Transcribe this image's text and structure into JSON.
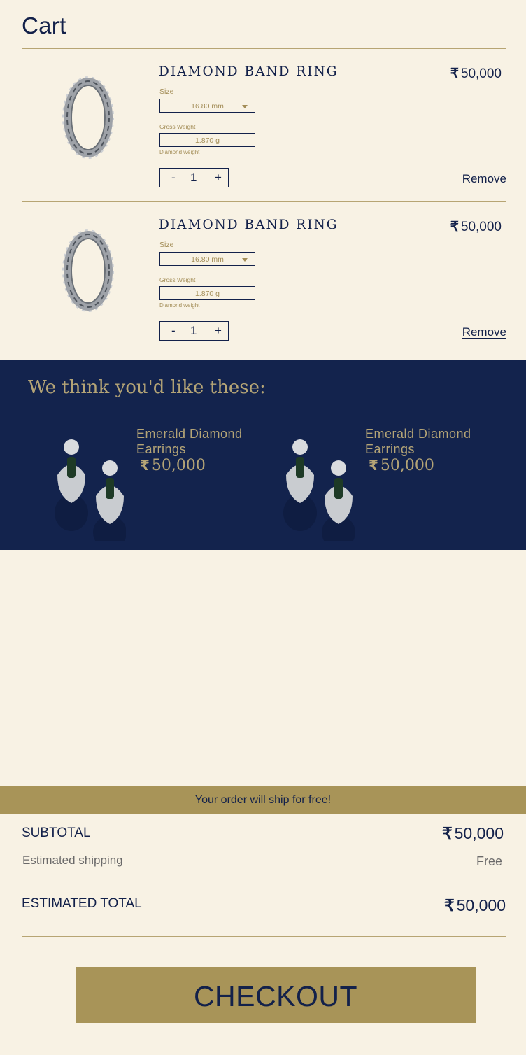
{
  "page": {
    "title": "Cart"
  },
  "cart": {
    "items": [
      {
        "name": "DIAMOND BAND RING",
        "currency": "₹",
        "price": "50,000",
        "size_label": "Size",
        "size_value": "16.80 mm",
        "gross_weight_label": "Gross Weight",
        "gross_weight_value": "1.870 g",
        "diamond_weight_label": "Diamond weight",
        "qty_minus": "-",
        "qty_value": "1",
        "qty_plus": "+",
        "remove_label": "Remove"
      },
      {
        "name": "DIAMOND BAND RING",
        "currency": "₹",
        "price": "50,000",
        "size_label": "Size",
        "size_value": "16.80 mm",
        "gross_weight_label": "Gross Weight",
        "gross_weight_value": "1.870 g",
        "diamond_weight_label": "Diamond weight",
        "qty_minus": "-",
        "qty_value": "1",
        "qty_plus": "+",
        "remove_label": "Remove"
      }
    ]
  },
  "recommendations": {
    "title": "We think you'd like these:",
    "products": [
      {
        "name": "Emerald Diamond Earrings",
        "currency": "₹",
        "price": "50,000"
      },
      {
        "name": "Emerald Diamond Earrings",
        "currency": "₹",
        "price": "50,000"
      }
    ]
  },
  "shipping_banner": "Your order will ship for free!",
  "summary": {
    "subtotal_label": "SUBTOTAL",
    "subtotal_currency": "₹",
    "subtotal_value": "50,000",
    "shipping_label": "Estimated shipping",
    "shipping_value": "Free",
    "total_label": "ESTIMATED TOTAL",
    "total_currency": "₹",
    "total_value": "50,000"
  },
  "checkout_label": "CHECKOUT",
  "colors": {
    "background": "#f8f2e4",
    "navy": "#13214a",
    "gold": "#a89458",
    "reco_background": "#13234d"
  }
}
